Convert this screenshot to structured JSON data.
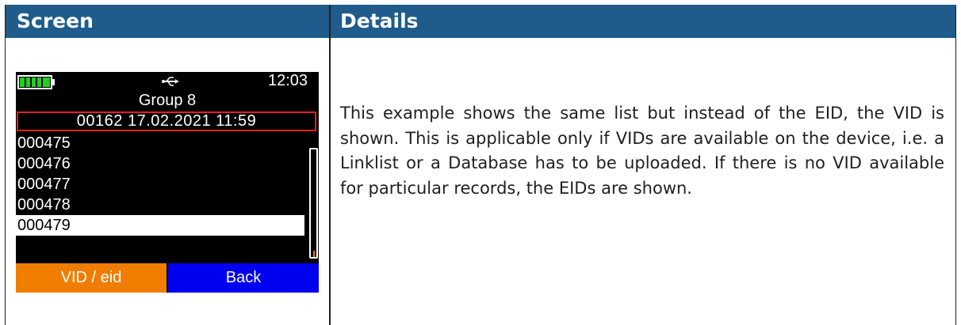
{
  "table": {
    "header": {
      "screen": "Screen",
      "details": "Details"
    },
    "colors": {
      "header_bg": "#1f5c8b",
      "header_text": "#ffffff"
    }
  },
  "device": {
    "status_bar": {
      "battery_icon": "battery-icon",
      "battery_level": 1.0,
      "usb_icon": "usb-icon",
      "time": "12:03"
    },
    "group_title": "Group 8",
    "selected_session": "00162 17.02.2021 11:59",
    "list": [
      "000475",
      "000476",
      "000477",
      "000478",
      "000479"
    ],
    "selected_index": 4,
    "softkeys": {
      "left": "VID / eid",
      "right": "Back"
    },
    "colors": {
      "left_key": "#f07d00",
      "right_key": "#0000f0",
      "session_border": "#e02020",
      "battery": "#20d020"
    }
  },
  "details": {
    "text": "This example shows the same list but instead of the EID, the VID is shown. This is applicable only if VIDs are available on the device, i.e. a Linklist or a Database has to be uploaded. If there is no VID available for particular records, the EIDs are shown."
  }
}
